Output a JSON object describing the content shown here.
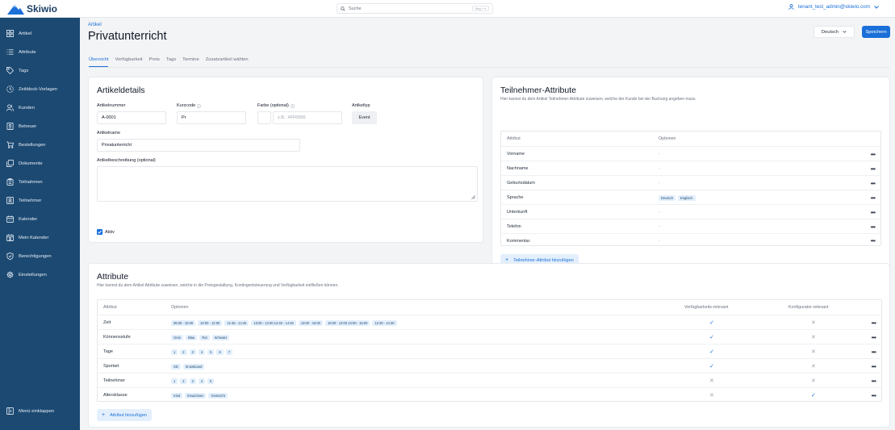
{
  "app": {
    "name": "Skiwio"
  },
  "search": {
    "placeholder": "Suche",
    "shortcut": "Strg + K"
  },
  "user": {
    "email": "tenant_test_admin@skiwio.com"
  },
  "sidebar": {
    "items": [
      {
        "label": "Artikel",
        "icon": "grid-icon"
      },
      {
        "label": "Attribute",
        "icon": "list-icon"
      },
      {
        "label": "Tags",
        "icon": "tag-icon"
      },
      {
        "label": "Zeitblock-Vorlagen",
        "icon": "clock-icon"
      },
      {
        "label": "Kunden",
        "icon": "users-icon"
      },
      {
        "label": "Betreuer",
        "icon": "id-card-icon"
      },
      {
        "label": "Bestellungen",
        "icon": "cart-icon"
      },
      {
        "label": "Dokumente",
        "icon": "documents-icon"
      },
      {
        "label": "Teilnahmen",
        "icon": "clipboard-icon"
      },
      {
        "label": "Teilnehmer",
        "icon": "contact-icon"
      },
      {
        "label": "Kalender",
        "icon": "calendar-icon"
      },
      {
        "label": "Mein Kalender",
        "icon": "user-calendar-icon"
      },
      {
        "label": "Berechtigungen",
        "icon": "shield-icon"
      },
      {
        "label": "Einstellungen",
        "icon": "gear-icon"
      }
    ],
    "collapse_label": "Menü einklappen"
  },
  "header": {
    "breadcrumb": "Artikel",
    "title": "Privatunterricht",
    "language": "Deutsch",
    "save_label": "Speichern"
  },
  "tabs": [
    "Übersicht",
    "Verfügbarkeit",
    "Preis",
    "Tags",
    "Termine",
    "Zusatzartikel wählen"
  ],
  "details": {
    "title": "Artikeldetails",
    "number_label": "Artikelnummer",
    "number_value": "A-0001",
    "short_label": "Kurzcode",
    "short_value": "Pr",
    "color_label": "Farbe (optional)",
    "color_placeholder": "z.B.: #FF0000",
    "type_label": "Artikeltyp",
    "type_value": "Event",
    "name_label": "Artikelname",
    "name_value": "Privatunterricht",
    "desc_label": "Artikelbeschreibung (optional)",
    "desc_value": "",
    "active_label": "Aktiv"
  },
  "participant_attrs": {
    "title": "Teilnehmer-Attribute",
    "subtitle": "Hier kannst du dem Artikel Teilnehmer-Attribute zuweisen, welche der Kunde bei der Buchung angeben muss.",
    "col_attr": "Attribut",
    "col_opts": "Optionen",
    "rows": [
      {
        "name": "Vorname",
        "options": []
      },
      {
        "name": "Nachname",
        "options": []
      },
      {
        "name": "Geburtsdatum",
        "options": []
      },
      {
        "name": "Sprache",
        "options": [
          "Deutsch",
          "Englisch"
        ]
      },
      {
        "name": "Unterkunft",
        "options": []
      },
      {
        "name": "Telefon",
        "options": []
      },
      {
        "name": "Kommentar",
        "options": []
      }
    ],
    "add_label": "Teilnehmer-Attribut hinzufügen"
  },
  "attributes": {
    "title": "Attribute",
    "subtitle": "Hier kannst du dem Artikel Attribute zuweisen, welche in die Preisgestaltung, Kontingentsteuerung und Verfügbarkeit einfließen können.",
    "col_attr": "Attribut",
    "col_opts": "Optionen",
    "col_avail": "Verfügbarkeits-relevant",
    "col_config": "Konfigurator-relevant",
    "rows": [
      {
        "name": "Zeit",
        "options": [
          "08:00 - 10:00",
          "10:00 - 12:00",
          "12:45 - 14:45",
          "10:00 - 12:00 12:45 - 14:45",
          "13:00 - 15:00",
          "10:00 - 12:00 13:00 - 15:00",
          "12:30 - 14:30"
        ],
        "avail": true,
        "config": false
      },
      {
        "name": "Könnensstufe",
        "options": [
          "Grün",
          "Blau",
          "Rot",
          "Schwarz"
        ],
        "avail": true,
        "config": false
      },
      {
        "name": "Tage",
        "options": [
          "1",
          "2",
          "3",
          "4",
          "5",
          "6",
          "7"
        ],
        "avail": true,
        "config": false
      },
      {
        "name": "Sportart",
        "options": [
          "Ski",
          "Snowboard"
        ],
        "avail": true,
        "config": false
      },
      {
        "name": "Teilnehmer",
        "options": [
          "1",
          "2",
          "3",
          "4",
          "5"
        ],
        "avail": false,
        "config": false
      },
      {
        "name": "Altersklasse",
        "options": [
          "Kind",
          "Erwachsen",
          "Gemischt"
        ],
        "avail": false,
        "config": true
      }
    ],
    "add_label": "Attribut hinzufügen"
  },
  "colors": {
    "primary": "#1a6fd8",
    "sidebar": "#1c4971",
    "chip": "#e3effc"
  }
}
